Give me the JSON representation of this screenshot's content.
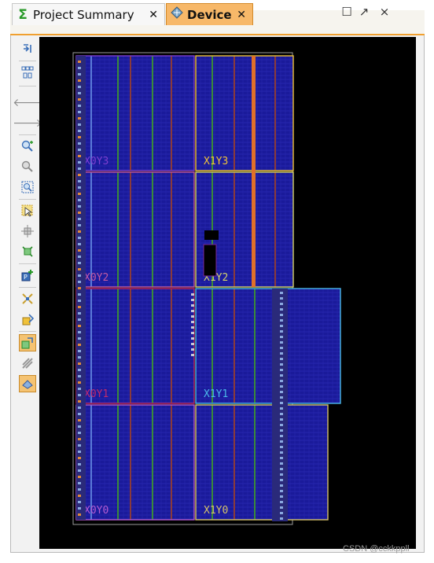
{
  "tabs": [
    {
      "label": "Project Summary",
      "icon": "sigma-icon",
      "active": false
    },
    {
      "label": "Device",
      "icon": "device-chip-icon",
      "active": true
    }
  ],
  "window_controls": {
    "restore": "☐",
    "float": "↗",
    "close": "×"
  },
  "tab_close_glyph": "✕",
  "toolbar_icons": [
    "collapse-icon",
    "expand-all-icon",
    "back-icon",
    "forward-icon",
    "zoom-in-icon",
    "zoom-out-icon",
    "zoom-fit-icon",
    "select-icon",
    "move-icon",
    "route-icon",
    "add-pblock-icon",
    "fit-selection-icon",
    "place-icon",
    "auto-assign-icon",
    "disabled-tool-icon",
    "routing-resources-icon"
  ],
  "clock_regions": [
    {
      "name": "X0Y3",
      "col": 0,
      "row": 3,
      "label_color": "#7d3fcf"
    },
    {
      "name": "X1Y3",
      "col": 1,
      "row": 3,
      "label_color": "#f0c23a"
    },
    {
      "name": "X0Y2",
      "col": 0,
      "row": 2,
      "label_color": "#c45aa0"
    },
    {
      "name": "X1Y2",
      "col": 1,
      "row": 2,
      "label_color": "#d6d36a"
    },
    {
      "name": "X0Y1",
      "col": 0,
      "row": 1,
      "label_color": "#c02a6a"
    },
    {
      "name": "X1Y1",
      "col": 1,
      "row": 1,
      "label_color": "#4ab8e8"
    },
    {
      "name": "X0Y0",
      "col": 0,
      "row": 0,
      "label_color": "#b45ad0"
    },
    {
      "name": "X1Y0",
      "col": 1,
      "row": 0,
      "label_color": "#d6c36a"
    }
  ],
  "colors": {
    "tab_active": "#f7b869",
    "accent": "#f0a030",
    "canvas_bg": "#000000",
    "fabric": "#1a1a9a"
  },
  "watermark": "CSDN @cckkppll"
}
